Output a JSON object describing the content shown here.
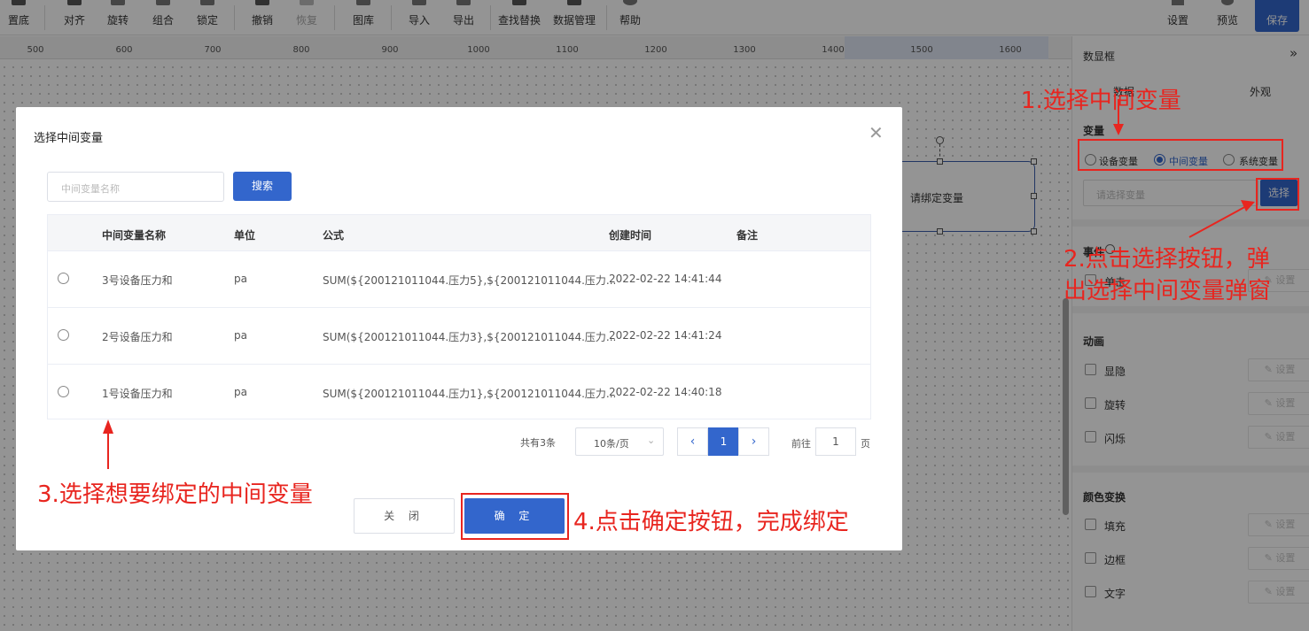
{
  "toolbar": {
    "items": [
      {
        "label": "置底",
        "icon": "send-to-back-icon"
      },
      {
        "label": "对齐",
        "icon": "align-icon"
      },
      {
        "label": "旋转",
        "icon": "rotate-icon"
      },
      {
        "label": "组合",
        "icon": "group-icon"
      },
      {
        "label": "锁定",
        "icon": "lock-icon"
      },
      {
        "label": "撤销",
        "icon": "undo-icon"
      },
      {
        "label": "恢复",
        "icon": "redo-icon"
      },
      {
        "label": "图库",
        "icon": "gallery-icon"
      },
      {
        "label": "导入",
        "icon": "import-icon"
      },
      {
        "label": "导出",
        "icon": "export-icon"
      },
      {
        "label": "查找替换",
        "icon": "find-replace-icon"
      },
      {
        "label": "数据管理",
        "icon": "data-manage-icon"
      },
      {
        "label": "帮助",
        "icon": "help-icon"
      }
    ],
    "settings_label": "设置",
    "preview_label": "预览",
    "save_label": "保存"
  },
  "ruler": {
    "ticks": [
      "500",
      "600",
      "700",
      "800",
      "900",
      "1000",
      "1100",
      "1200",
      "1300",
      "1400",
      "1500",
      "1600"
    ]
  },
  "canvas": {
    "shape_text": "请绑定变量"
  },
  "panel": {
    "title": "数显框",
    "tabs": [
      "数据",
      "外观"
    ],
    "variable_section": "变量",
    "radio_options": [
      "设备变量",
      "中间变量",
      "系统变量"
    ],
    "selected_radio": "中间变量",
    "variable_placeholder": "请选择变量",
    "choose_button": "选择",
    "event_section": "事件",
    "event_items": [
      "单击"
    ],
    "animation_section": "动画",
    "animation_items": [
      "显隐",
      "旋转",
      "闪烁"
    ],
    "color_section": "颜色变换",
    "color_items": [
      "填充",
      "边框",
      "文字"
    ],
    "setting_button": "设置"
  },
  "modal": {
    "title": "选择中间变量",
    "search_placeholder": "中间变量名称",
    "search_button": "搜索",
    "columns": [
      "中间变量名称",
      "单位",
      "公式",
      "创建时间",
      "备注"
    ],
    "rows": [
      {
        "name": "3号设备压力和",
        "unit": "pa",
        "formula": "SUM(${200121011044.压力5},${200121011044.压力...",
        "created": "2022-02-22 14:41:44",
        "note": ""
      },
      {
        "name": "2号设备压力和",
        "unit": "pa",
        "formula": "SUM(${200121011044.压力3},${200121011044.压力...",
        "created": "2022-02-22 14:41:24",
        "note": ""
      },
      {
        "name": "1号设备压力和",
        "unit": "pa",
        "formula": "SUM(${200121011044.压力1},${200121011044.压力...",
        "created": "2022-02-22 14:40:18",
        "note": ""
      }
    ],
    "pagination": {
      "total_text": "共有3条",
      "page_size": "10条/页",
      "current_page": "1",
      "goto_label": "前往",
      "goto_value": "1",
      "page_suffix": "页"
    },
    "close_button": "关 闭",
    "confirm_button": "确 定"
  },
  "annotations": {
    "step1": "1.选择中间变量",
    "step2_line1": "2.点击选择按钮，弹",
    "step2_line2": "出选择中间变量弹窗",
    "step3": "3.选择想要绑定的中间变量",
    "step4": "4.点击确定按钮，完成绑定",
    "color": "#e8251f"
  },
  "colors": {
    "primary": "#3366cc",
    "shape_border": "#3b5dab"
  }
}
